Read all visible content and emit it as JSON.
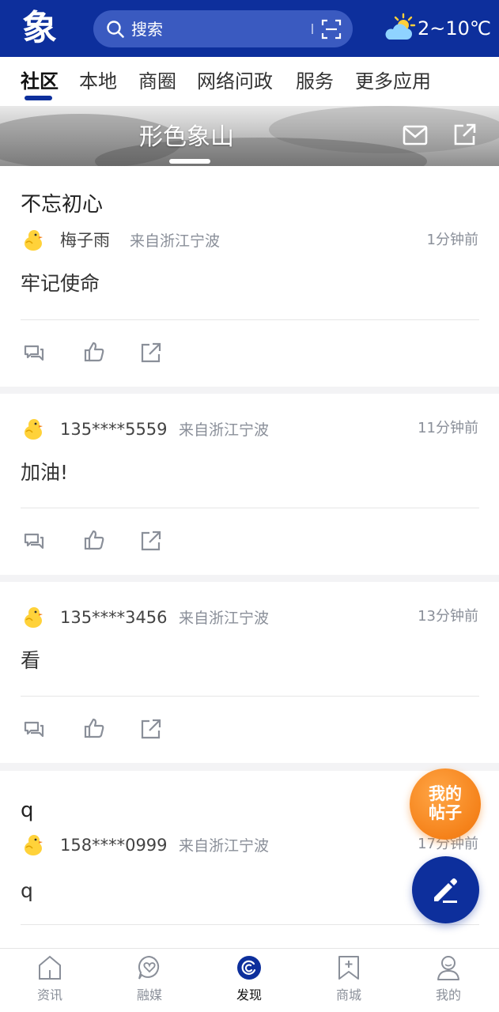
{
  "header": {
    "logo": "象",
    "search_placeholder": "搜索",
    "weather": {
      "icon": "partly-cloudy-icon",
      "temp": "2~10℃"
    }
  },
  "tabs": [
    {
      "label": "社区",
      "active": true
    },
    {
      "label": "本地"
    },
    {
      "label": "商圈"
    },
    {
      "label": "网络问政"
    },
    {
      "label": "服务"
    },
    {
      "label": "更多应用"
    }
  ],
  "banner": {
    "title": "形色象山"
  },
  "posts": [
    {
      "title": "不忘初心",
      "author": "梅子雨",
      "location": "来自浙江宁波",
      "time": "1分钟前",
      "content": "牢记使命"
    },
    {
      "title": "",
      "author": "135****5559",
      "location": "来自浙江宁波",
      "time": "11分钟前",
      "content": "加油!"
    },
    {
      "title": "",
      "author": "135****3456",
      "location": "来自浙江宁波",
      "time": "13分钟前",
      "content": "看"
    },
    {
      "title": "q",
      "author": "158****0999",
      "location": "来自浙江宁波",
      "time": "17分钟前",
      "content": "q"
    }
  ],
  "floating": {
    "my_posts": [
      "我的",
      "帖子"
    ]
  },
  "bottom_nav": [
    {
      "label": "资讯",
      "icon": "home-icon"
    },
    {
      "label": "融媒",
      "icon": "heart-chat-icon"
    },
    {
      "label": "发现",
      "icon": "discover-icon",
      "active": true
    },
    {
      "label": "商城",
      "icon": "bookmark-plus-icon"
    },
    {
      "label": "我的",
      "icon": "user-icon"
    }
  ],
  "colors": {
    "brand": "#0d2f9c",
    "accent": "#f5821a"
  }
}
